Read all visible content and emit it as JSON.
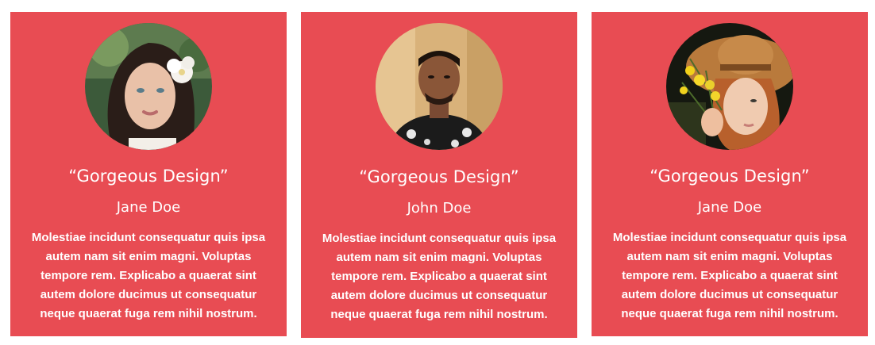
{
  "testimonials": [
    {
      "quote": "“Gorgeous Design”",
      "name": "Jane Doe",
      "text": "Molestiae incidunt consequatur quis ipsa autem nam sit enim magni. Voluptas tempore rem. Explicabo a quaerat sint autem dolore ducimus ut consequatur neque quaerat fuga rem nihil nostrum.",
      "avatar": "woman-with-white-flower-photo"
    },
    {
      "quote": "“Gorgeous Design”",
      "name": "John Doe",
      "text": "Molestiae incidunt consequatur quis ipsa autem nam sit enim magni. Voluptas tempore rem. Explicabo a quaerat sint autem dolore ducimus ut consequatur neque quaerat fuga rem nihil nostrum.",
      "avatar": "man-in-floral-shirt-photo"
    },
    {
      "quote": "“Gorgeous Design”",
      "name": "Jane Doe",
      "text": "Molestiae incidunt consequatur quis ipsa autem nam sit enim magni. Voluptas tempore rem. Explicabo a quaerat sint autem dolore ducimus ut consequatur neque quaerat fuga rem nihil nostrum.",
      "avatar": "woman-in-straw-hat-photo"
    }
  ],
  "colors": {
    "card_background": "#e84c53",
    "text": "#ffffff"
  }
}
